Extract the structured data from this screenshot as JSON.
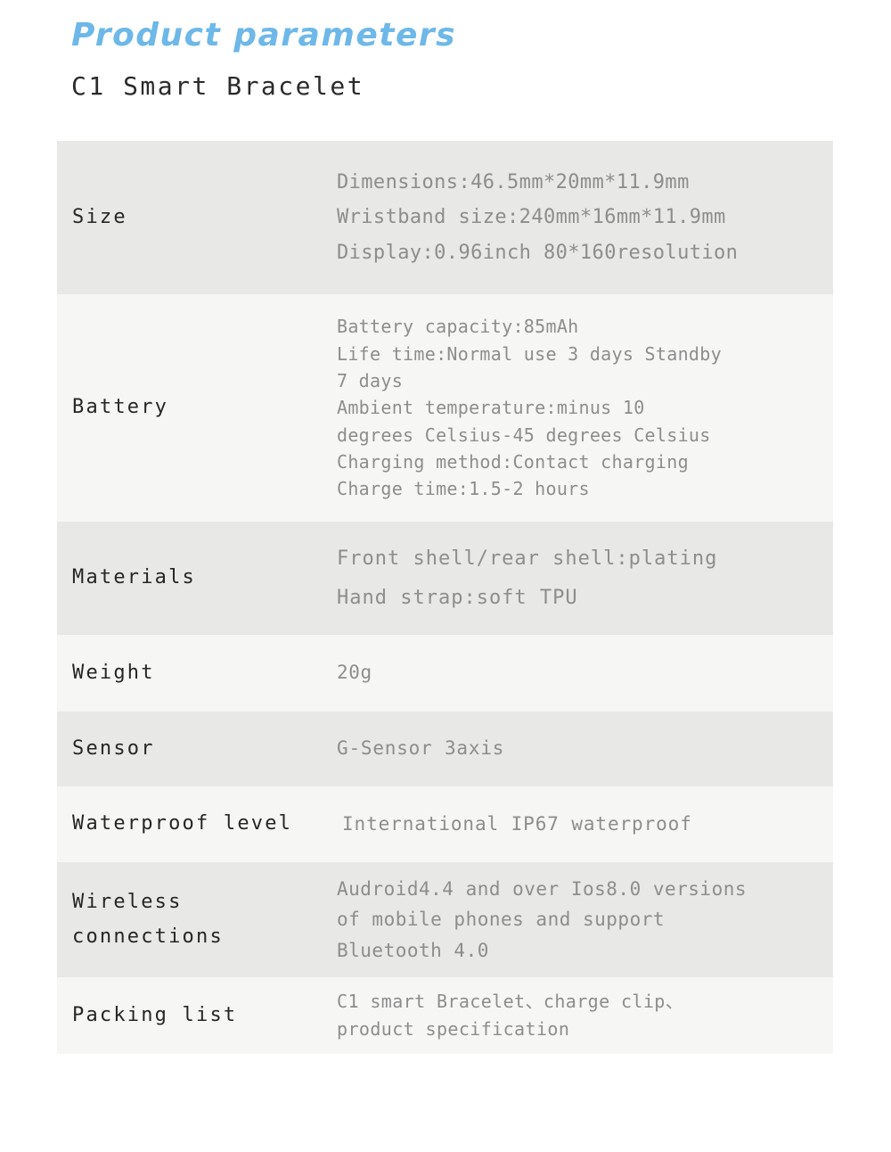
{
  "header": {
    "title": "Product parameters",
    "product_name": "C1 Smart Bracelet",
    "title_color": "#6db8e8"
  },
  "table": {
    "row_shade_gray": "#e8e8e6",
    "row_shade_light": "#f6f6f5",
    "label_color": "#262626",
    "value_color": "#8d8d8d",
    "rows": [
      {
        "key": "size",
        "label": "Size",
        "value": "Dimensions:46.5mm*20mm*11.9mm\nWristband size:240mm*16mm*11.9mm\nDisplay:0.96inch 80*160resolution"
      },
      {
        "key": "battery",
        "label": "Battery",
        "value": "Battery capacity:85mAh\nLife time:Normal use 3 days Standby\n7 days\nAmbient temperature:minus 10\ndegrees Celsius-45 degrees Celsius\nCharging method:Contact charging\nCharge time:1.5-2 hours"
      },
      {
        "key": "materials",
        "label": "Materials",
        "value": "Front shell/rear shell:plating\nHand strap:soft TPU"
      },
      {
        "key": "weight",
        "label": "Weight",
        "value": "20g"
      },
      {
        "key": "sensor",
        "label": "Sensor",
        "value": "G-Sensor 3axis"
      },
      {
        "key": "waterproof",
        "label": "Waterproof level",
        "value": "International IP67 waterproof"
      },
      {
        "key": "wireless",
        "label": "Wireless\nconnections",
        "value": "Audroid4.4 and over Ios8.0 versions\nof mobile phones and support\nBluetooth 4.0"
      },
      {
        "key": "packing",
        "label": "Packing list",
        "value": "C1 smart Bracelet、charge clip、\nproduct specification"
      }
    ]
  }
}
